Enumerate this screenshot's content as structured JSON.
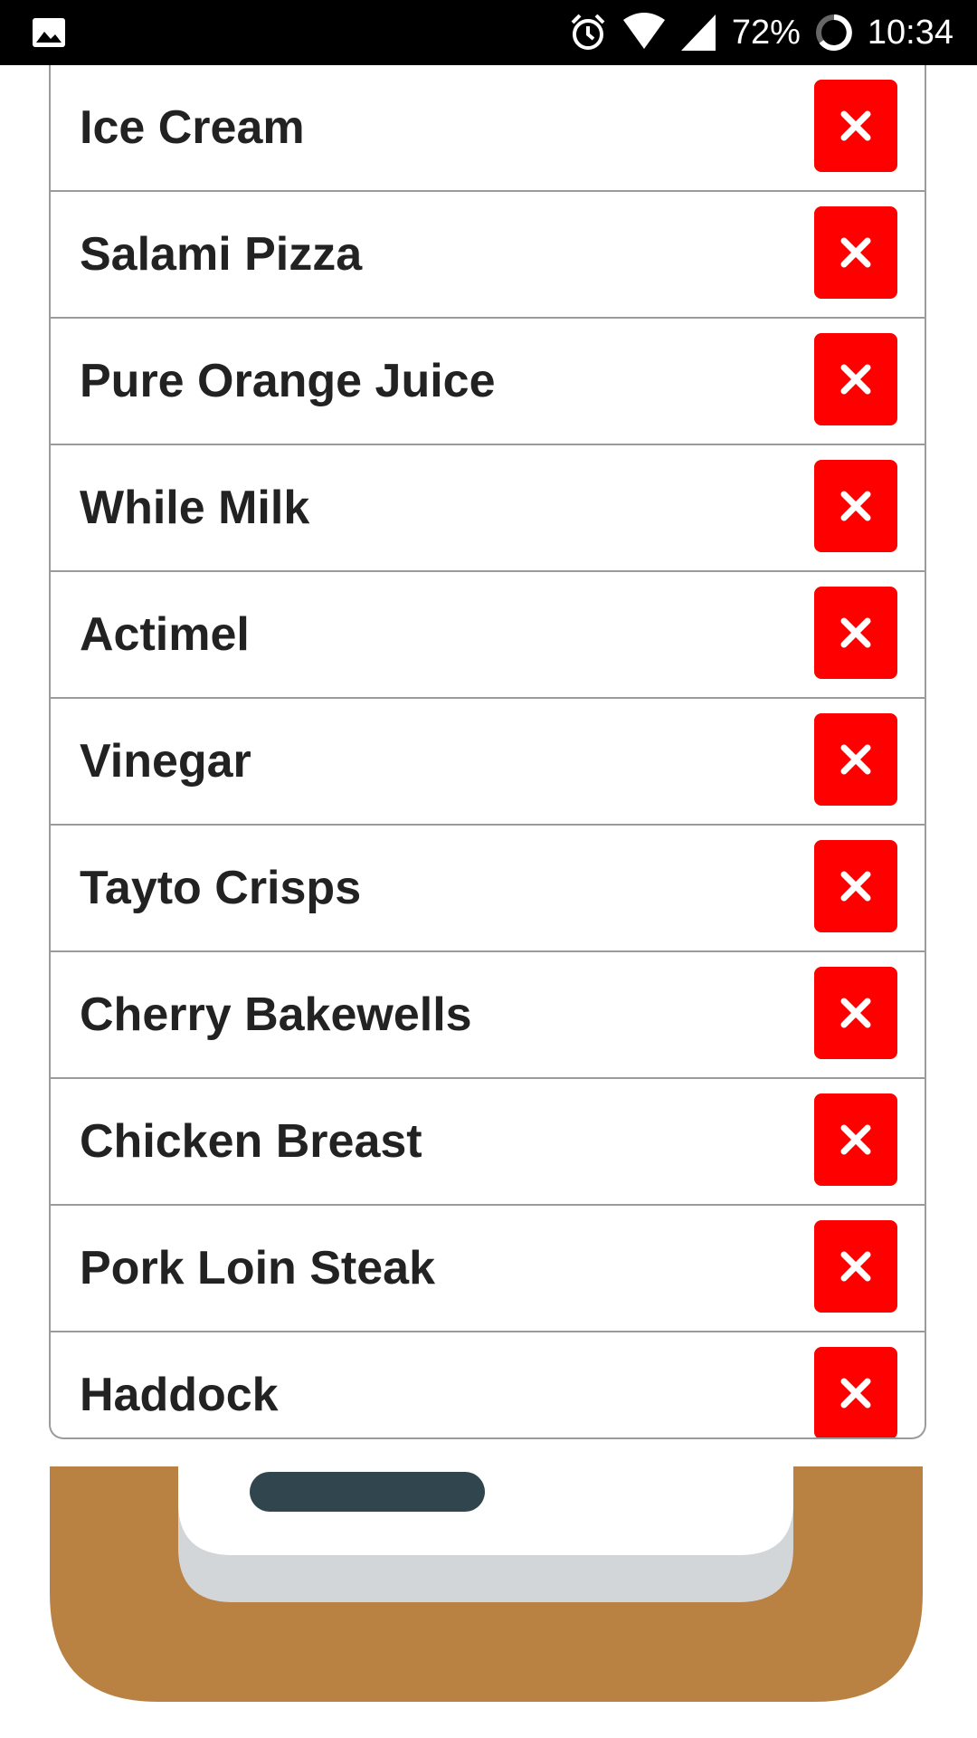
{
  "status_bar": {
    "battery": "72%",
    "time": "10:34",
    "icons": [
      "image-icon",
      "alarm-icon",
      "wifi-icon",
      "cell-signal-icon",
      "battery-icon"
    ]
  },
  "list": {
    "delete_icon": "close-icon",
    "delete_color": "#ff0000",
    "items": [
      {
        "label": "Ice Cream"
      },
      {
        "label": "Salami Pizza"
      },
      {
        "label": "Pure Orange Juice"
      },
      {
        "label": "While Milk"
      },
      {
        "label": "Actimel"
      },
      {
        "label": "Vinegar"
      },
      {
        "label": "Tayto Crisps"
      },
      {
        "label": "Cherry Bakewells"
      },
      {
        "label": "Chicken Breast"
      },
      {
        "label": "Pork Loin Steak"
      },
      {
        "label": "Haddock"
      }
    ]
  },
  "illustration": {
    "name": "clipboard-illustration",
    "colors": {
      "board": "#b98142",
      "paper": "#ffffff",
      "shadow": "#d3d6d9",
      "clip": "#30454d"
    }
  }
}
